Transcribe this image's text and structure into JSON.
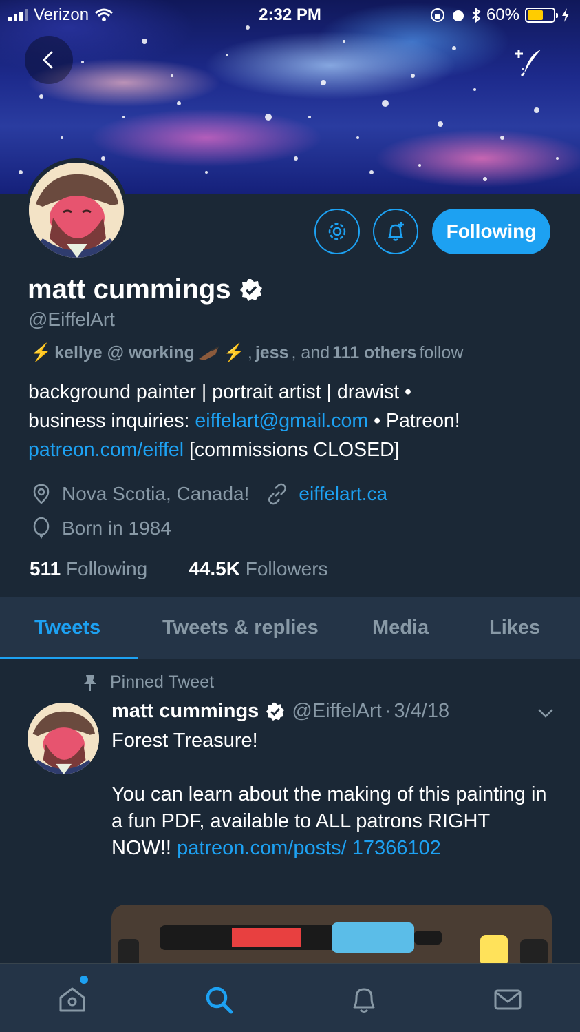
{
  "status_bar": {
    "carrier": "Verizon",
    "time": "2:32 PM",
    "battery": "60%"
  },
  "header": {
    "back_icon": "chevron-left-icon",
    "compose_icon": "compose-tweet-icon"
  },
  "profile": {
    "name": "matt cummings",
    "handle": "@EiffelArt",
    "follow_button": "Following",
    "followed_by": {
      "name1": "kellye @ working",
      "name2": "jess",
      "connector1": ",",
      "connector2": ", and",
      "others": "111 others",
      "suffix": "follow"
    },
    "bio": {
      "line1": "background painter | portrait artist | drawist •",
      "line2_prefix": "business inquiries:",
      "email": "eiffelart@gmail.com",
      "line2_suffix": "• Patreon!",
      "patreon": "patreon.com/eiffel",
      "line3_suffix": "[commissions CLOSED]"
    },
    "location": "Nova Scotia, Canada!",
    "website": "eiffelart.ca",
    "birth": "Born in 1984",
    "following_count": "511",
    "following_label": "Following",
    "followers_count": "44.5K",
    "followers_label": "Followers"
  },
  "tabs": [
    {
      "label": "Tweets",
      "active": true
    },
    {
      "label": "Tweets & replies",
      "active": false
    },
    {
      "label": "Media",
      "active": false
    },
    {
      "label": "Likes",
      "active": false
    }
  ],
  "tweet": {
    "pinned_label": "Pinned Tweet",
    "author": "matt cummings",
    "handle": "@EiffelArt",
    "separator": "·",
    "date": "3/4/18",
    "text_line1": "Forest Treasure!",
    "text_body": "You can learn about the making of this painting in a fun PDF, available to ALL patrons RIGHT NOW!!",
    "link": "patreon.com/posts/ 17366102"
  },
  "bottom_nav": [
    {
      "icon": "home-icon"
    },
    {
      "icon": "search-icon"
    },
    {
      "icon": "notifications-icon"
    },
    {
      "icon": "messages-icon"
    }
  ],
  "colors": {
    "accent": "#1da1f2",
    "background": "#1b2836",
    "tab_bar": "#243447",
    "secondary_text": "#8899a6"
  }
}
